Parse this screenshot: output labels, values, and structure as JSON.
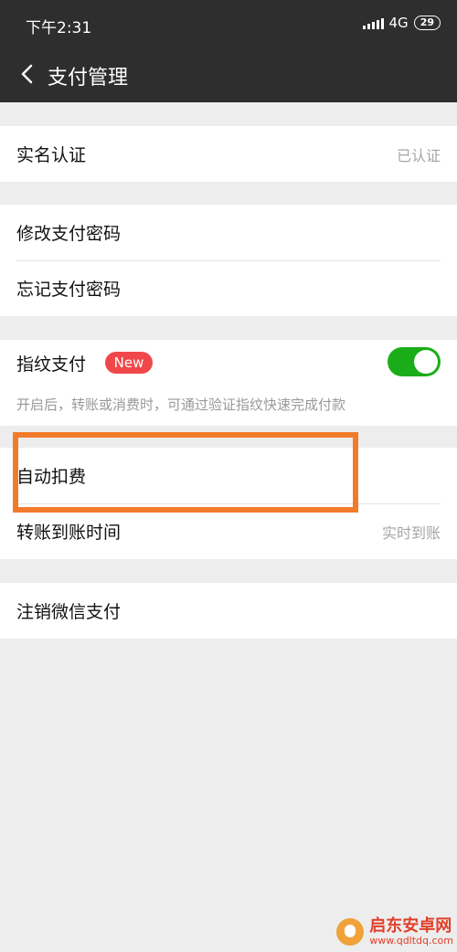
{
  "status_bar": {
    "time": "下午2:31",
    "network": "4G",
    "battery": "29"
  },
  "nav": {
    "title": "支付管理"
  },
  "sections": {
    "identity": {
      "label": "实名认证",
      "value": "已认证"
    },
    "change_password": {
      "label": "修改支付密码"
    },
    "forgot_password": {
      "label": "忘记支付密码"
    },
    "fingerprint": {
      "label": "指纹支付",
      "badge": "New",
      "enabled": true,
      "hint": "开启后，转账或消费时，可通过验证指纹快速完成付款"
    },
    "auto_deduct": {
      "label": "自动扣费"
    },
    "transfer_time": {
      "label": "转账到账时间",
      "value": "实时到账"
    },
    "cancel_pay": {
      "label": "注销微信支付"
    }
  },
  "watermark": {
    "title": "启东安卓网",
    "url": "www.qdltdq.com"
  },
  "colors": {
    "topbar": "#2e2e2e",
    "background": "#ededed",
    "toggle_on": "#1aad19",
    "badge": "#f0484a",
    "highlight": "#f27b2b"
  }
}
